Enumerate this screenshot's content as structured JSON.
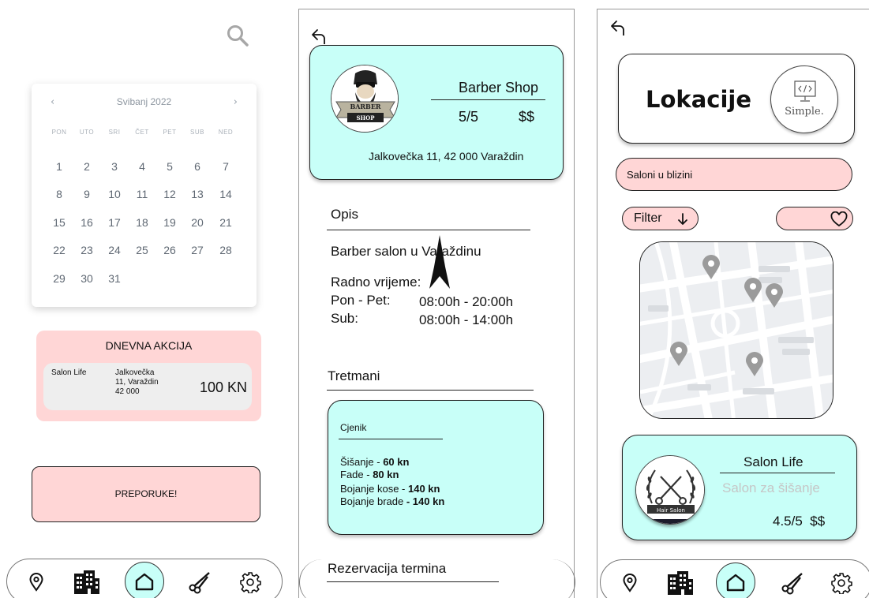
{
  "home": {
    "calendar": {
      "month_label": "Svibanj 2022",
      "prev_icon": "chevron-left-icon",
      "next_icon": "chevron-right-icon",
      "weekdays": [
        "PON",
        "UTO",
        "SRI",
        "ČET",
        "PET",
        "SUB",
        "NED"
      ],
      "days": [
        "1",
        "2",
        "3",
        "4",
        "5",
        "6",
        "7",
        "8",
        "9",
        "10",
        "11",
        "12",
        "13",
        "14",
        "15",
        "16",
        "17",
        "18",
        "19",
        "20",
        "21",
        "22",
        "23",
        "24",
        "25",
        "26",
        "27",
        "28",
        "29",
        "30",
        "31"
      ]
    },
    "deal": {
      "title": "DNEVNA AKCIJA",
      "salon": "Salon Life",
      "address_line1": "Jalkovečka",
      "address_line2": "11, Varaždin",
      "address_line3": "42 000",
      "price": "100 KN"
    },
    "recommendations_label": "PREPORUKE!"
  },
  "detail": {
    "shop_name": "Barber Shop",
    "rating": "5/5",
    "price_level": "$$",
    "address": "Jalkovečka 11, 42 000 Varaždin",
    "logo_lines": [
      "BARBER",
      "SHOP"
    ],
    "description_title": "Opis",
    "description": "Barber salon u Varaždinu",
    "hours_title": "Radno vrijeme:",
    "hours": [
      {
        "day": "Pon - Pet:",
        "time": "08:00h - 20:00h"
      },
      {
        "day": "Sub:",
        "time": "08:00h - 14:00h"
      }
    ],
    "treatments_title": "Tretmani",
    "price_list": {
      "title": "Cjenik",
      "items": [
        {
          "name": "Šišanje - ",
          "price": "60 kn"
        },
        {
          "name": "Fade - ",
          "price": "80 kn"
        },
        {
          "name": "Bojanje kose - ",
          "price": "140 kn"
        },
        {
          "name": "Bojanje brade ",
          "price": "- 140 kn"
        }
      ]
    },
    "reservation_title": "Rezervacija termina"
  },
  "locations": {
    "title": "Lokacije",
    "brand_label": "Simple.",
    "nearby_label": "Saloni u blizini",
    "filter_label": "Filter",
    "salon": {
      "name": "Salon Life",
      "subtitle": "Salon za šišanje",
      "rating": "4.5/5",
      "price_level": "$$",
      "logo_label": "Hair Salon"
    }
  },
  "nav": {
    "items": [
      "location-icon",
      "building-icon",
      "home-icon",
      "scissors-icon",
      "gear-icon"
    ]
  },
  "colors": {
    "pink": "#ffd6d6",
    "cyan": "#c8fff8",
    "grey_card": "#eeeeee",
    "map_bg": "#eef0f2",
    "pin": "#9b9b9b"
  }
}
